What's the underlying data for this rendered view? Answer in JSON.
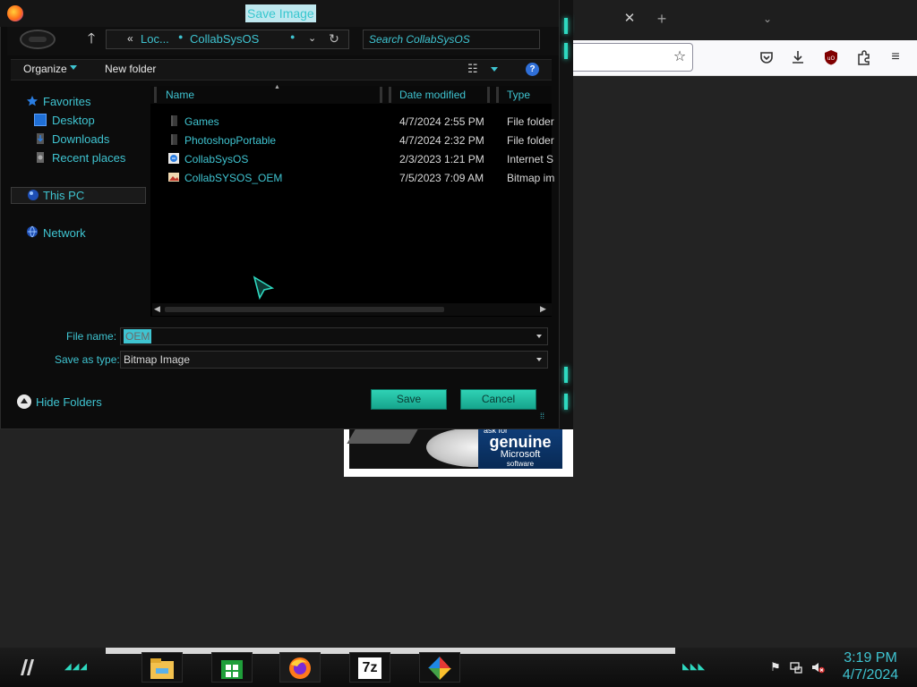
{
  "dialog": {
    "title": "Save Image",
    "address": {
      "crumbs": [
        "Loc...",
        "CollabSysOS"
      ],
      "chevron": "«"
    },
    "search_placeholder": "Search CollabSysOS",
    "toolbar": {
      "organize_label": "Organize",
      "new_folder_label": "New folder",
      "help_label": "?"
    },
    "nav_pane": {
      "favorites_label": "Favorites",
      "items": [
        {
          "label": "Desktop"
        },
        {
          "label": "Downloads"
        },
        {
          "label": "Recent places"
        }
      ],
      "this_pc_label": "This PC",
      "network_label": "Network"
    },
    "columns": {
      "name": "Name",
      "date_modified": "Date modified",
      "type": "Type"
    },
    "files": [
      {
        "name": "Games",
        "date": "4/7/2024 2:55 PM",
        "type": "File folder",
        "icon": "folder-icon"
      },
      {
        "name": "PhotoshopPortable",
        "date": "4/7/2024 2:32 PM",
        "type": "File folder",
        "icon": "folder-icon"
      },
      {
        "name": "CollabSysOS",
        "date": "2/3/2023 1:21 PM",
        "type": "Internet S",
        "icon": "internet-shortcut-icon"
      },
      {
        "name": "CollabSYSOS_OEM",
        "date": "7/5/2023 7:09 AM",
        "type": "Bitmap im",
        "icon": "bitmap-file-icon"
      }
    ],
    "file_name_label": "File name:",
    "file_name_value": "OEM",
    "save_type_label": "Save as type:",
    "save_type_value": "Bitmap Image",
    "hide_folders_label": "Hide Folders",
    "save_label": "Save",
    "cancel_label": "Cancel"
  },
  "browser": {
    "tab_close": "✕",
    "new_tab": "+",
    "tab_list": "⌄"
  },
  "canvas_badge": {
    "line1": "ask for",
    "line2": "genuine",
    "line3": "Microsoft",
    "line4": "software"
  },
  "taskbar": {
    "apps": [
      "file-explorer-icon",
      "store-icon",
      "firefox-icon",
      "7zip-icon",
      "pinwheel-app-icon"
    ],
    "sevenzip_label": "7z",
    "clock_time": "3:19 PM",
    "clock_date": "4/7/2024"
  },
  "colors": {
    "accent": "#3fc4d1",
    "glow": "#2ed9c0",
    "button": "#1fb99c"
  }
}
